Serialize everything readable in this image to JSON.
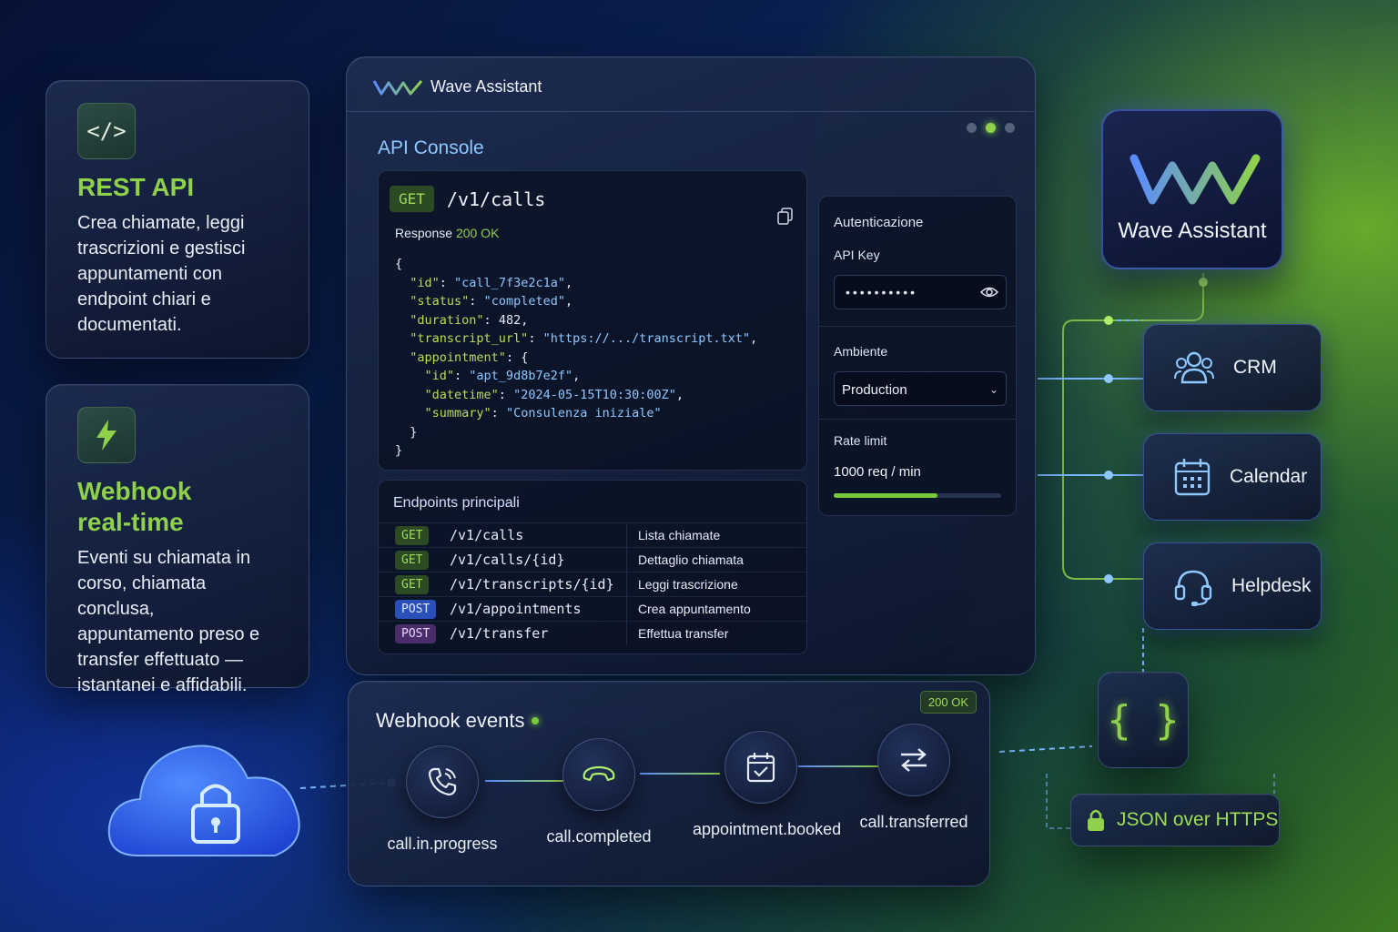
{
  "features": [
    {
      "icon": "code-icon",
      "title": "REST API",
      "lines": [
        "Crea chiamate, leggi",
        "trascrizioni e gestisci",
        "appuntamenti con",
        "endpoint chiari e",
        "documentati."
      ]
    },
    {
      "icon": "lightning-icon",
      "title_lines": [
        "Webhook",
        "real-time"
      ],
      "lines": [
        "Eventi su chiamata in",
        "corso, chiamata conclusa,",
        "appuntamento preso e",
        "transfer effettuato —",
        "istantanei e affidabili."
      ]
    }
  ],
  "console": {
    "app_name": "Wave Assistant",
    "title": "API Console",
    "request": {
      "method": "GET",
      "path": "/v1/calls"
    },
    "response_label": "Response",
    "response_status": "200 OK",
    "json": {
      "open": "{",
      "id_key": "\"id\"",
      "id_val": "\"call_7f3e2c1a\"",
      "status_key": "\"status\"",
      "status_val": "\"completed\"",
      "duration_key": "\"duration\"",
      "duration_val": "482",
      "transcript_key": "\"transcript_url\"",
      "transcript_val": "\"https://.../transcript.txt\"",
      "appointment_key": "\"appointment\"",
      "apt_id_key": "\"id\"",
      "apt_id_val": "\"apt_9d8b7e2f\"",
      "datetime_key": "\"datetime\"",
      "datetime_val": "\"2024-05-15T10:30:00Z\"",
      "summary_key": "\"summary\"",
      "summary_val": "\"Consulenza iniziale\"",
      "inner_close": "}",
      "close": "}"
    },
    "endpoints_title": "Endpoints principali",
    "endpoints": [
      {
        "method": "GET",
        "path": "/v1/calls",
        "desc": "Lista chiamate"
      },
      {
        "method": "GET",
        "path": "/v1/calls/{id}",
        "desc": "Dettaglio chiamata"
      },
      {
        "method": "GET",
        "path": "/v1/transcripts/{id}",
        "desc": "Leggi trascrizione"
      },
      {
        "method": "POST",
        "path": "/v1/appointments",
        "desc": "Crea appuntamento"
      },
      {
        "method": "POST",
        "path": "/v1/transfer",
        "desc": "Effettua transfer"
      }
    ],
    "auth": {
      "section": "Autenticazione",
      "api_key_label": "API Key",
      "api_key_value": "••••••••••",
      "env_label": "Ambiente",
      "env_value": "Production",
      "rate_label": "Rate limit",
      "rate_value": "1000 req / min",
      "rate_fraction": 0.62
    }
  },
  "webhook": {
    "title": "Webhook events",
    "status": "200 OK",
    "events": [
      {
        "icon": "phone-ringing-icon",
        "label": "call.in.progress"
      },
      {
        "icon": "phone-hangup-icon",
        "label": "call.completed"
      },
      {
        "icon": "calendar-check-icon",
        "label": "appointment.booked"
      },
      {
        "icon": "transfer-arrows-icon",
        "label": "call.transferred"
      }
    ]
  },
  "brand": {
    "name": "Wave Assistant"
  },
  "integrations": [
    {
      "icon": "users-icon",
      "label": "CRM"
    },
    {
      "icon": "calendar-icon",
      "label": "Calendar"
    },
    {
      "icon": "headset-icon",
      "label": "Helpdesk"
    }
  ],
  "transport": {
    "json_symbol": "{ }",
    "label": "JSON over HTTPS"
  },
  "colors": {
    "accent_green": "#8fd14a",
    "accent_blue": "#5b8cff"
  }
}
